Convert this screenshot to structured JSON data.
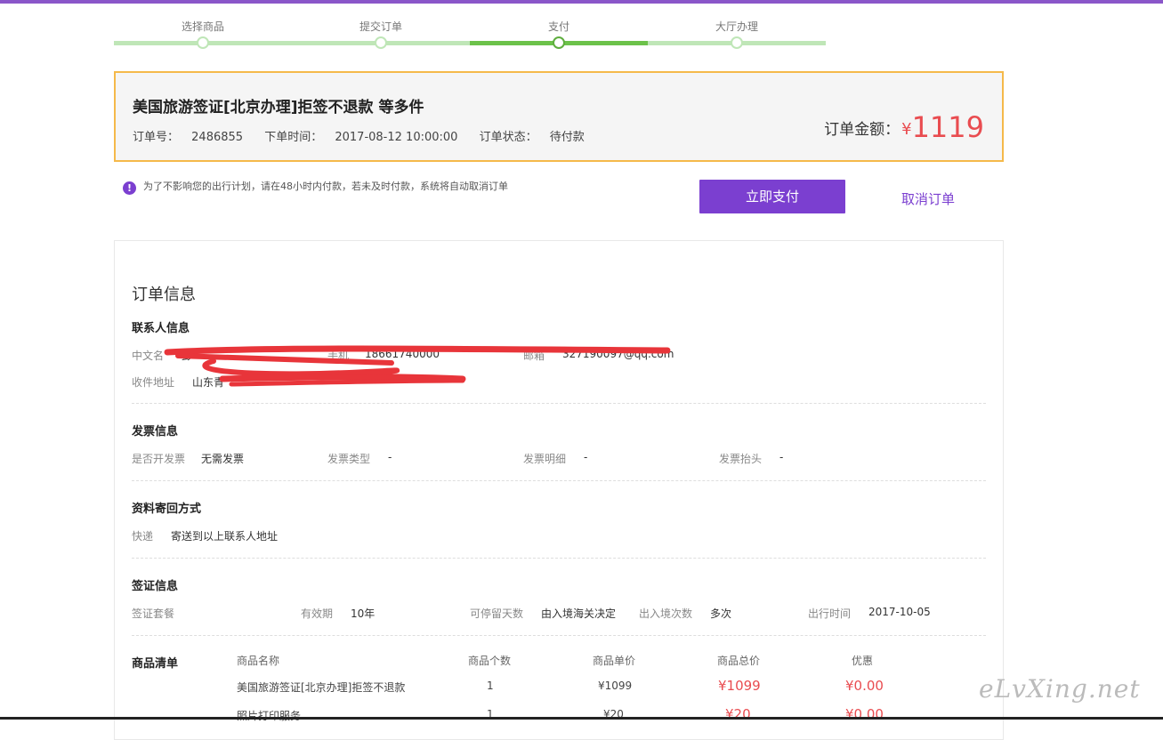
{
  "steps": [
    "选择商品",
    "提交订单",
    "支付",
    "大厅办理"
  ],
  "order": {
    "title": "美国旅游签证[北京办理]拒签不退款 等多件",
    "no_label": "订单号：",
    "no": "2486855",
    "time_label": "下单时间：",
    "time": "2017-08-12 10:00:00",
    "status_label": "订单状态：",
    "status": "待付款",
    "amount_label": "订单金额：",
    "currency": "¥",
    "amount": "1119"
  },
  "notice": "为了不影响您的出行计划，请在48小时内付款，若未及时付款，系统将自动取消订单",
  "actions": {
    "pay": "立即支付",
    "cancel": "取消订单"
  },
  "details": {
    "title": "订单信息",
    "contact": {
      "title": "联系人信息",
      "name_label": "中文名",
      "name": "彭",
      "phone_label": "手机",
      "phone": "18661740000",
      "email_label": "邮箱",
      "email": "327190097@qq.com",
      "address_label": "收件地址",
      "address": "山东青"
    },
    "invoice": {
      "title": "发票信息",
      "need_label": "是否开发票",
      "need": "无需发票",
      "type_label": "发票类型",
      "type": "-",
      "detail_label": "发票明细",
      "detail": "-",
      "head_label": "发票抬头",
      "head": "-"
    },
    "mail": {
      "title": "资料寄回方式",
      "method_label": "快递",
      "method": "寄送到以上联系人地址"
    },
    "visa": {
      "title": "签证信息",
      "package_label": "签证套餐",
      "validity_label": "有效期",
      "validity": "10年",
      "stay_label": "可停留天数",
      "stay": "由入境海关决定",
      "entries_label": "出入境次数",
      "entries": "多次",
      "travel_label": "出行时间",
      "travel": "2017-10-05"
    },
    "goods": {
      "title": "商品清单",
      "headers": [
        "商品名称",
        "商品个数",
        "商品单价",
        "商品总价",
        "优惠"
      ],
      "rows": [
        [
          "美国旅游签证[北京办理]拒签不退款",
          "1",
          "¥1099",
          "¥1099",
          "¥0.00"
        ],
        [
          "照片打印服务",
          "1",
          "¥20",
          "¥20",
          "¥0.00"
        ]
      ]
    }
  },
  "watermark": "eLvXing.net"
}
